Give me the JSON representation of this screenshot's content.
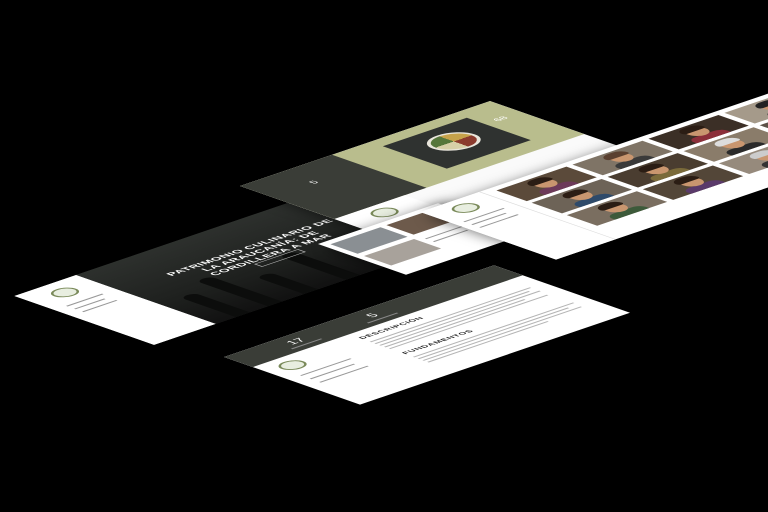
{
  "hero": {
    "title": "PATRIMONIO CULINARIO DE LA ARAUCANÍA: DE CORDILLERA A MAR"
  },
  "olive_page": {
    "stat_left": "5",
    "stat_right": "68"
  },
  "description_page": {
    "stat_left": "17",
    "stat_right": "5",
    "sections": [
      "DESCRIPCIÓN",
      "FUNDAMENTOS"
    ]
  },
  "colors": {
    "olive": "#b9bd8d",
    "dark": "#3a3d37",
    "hero_bg": "#262826",
    "background": "#000000"
  }
}
